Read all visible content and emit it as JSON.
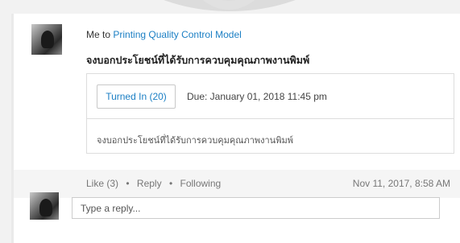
{
  "post": {
    "author": "Me",
    "connector": "to",
    "group": "Printing Quality Control Model",
    "title": "จงบอกประโยชน์ที่ได้รับการควบคุมคุณภาพงานพิมพ์"
  },
  "assignment": {
    "turned_in_label": "Turned In (20)",
    "due_label": "Due: January 01, 2018 11:45 pm",
    "body": "จงบอกประโยชน์ที่ได้รับการควบคุมคุณภาพงานพิมพ์"
  },
  "actions": {
    "like": "Like (3)",
    "reply": "Reply",
    "following": "Following",
    "separator": "•",
    "timestamp": "Nov 11, 2017, 8:58 AM"
  },
  "reply_box": {
    "placeholder": "Type a reply..."
  }
}
